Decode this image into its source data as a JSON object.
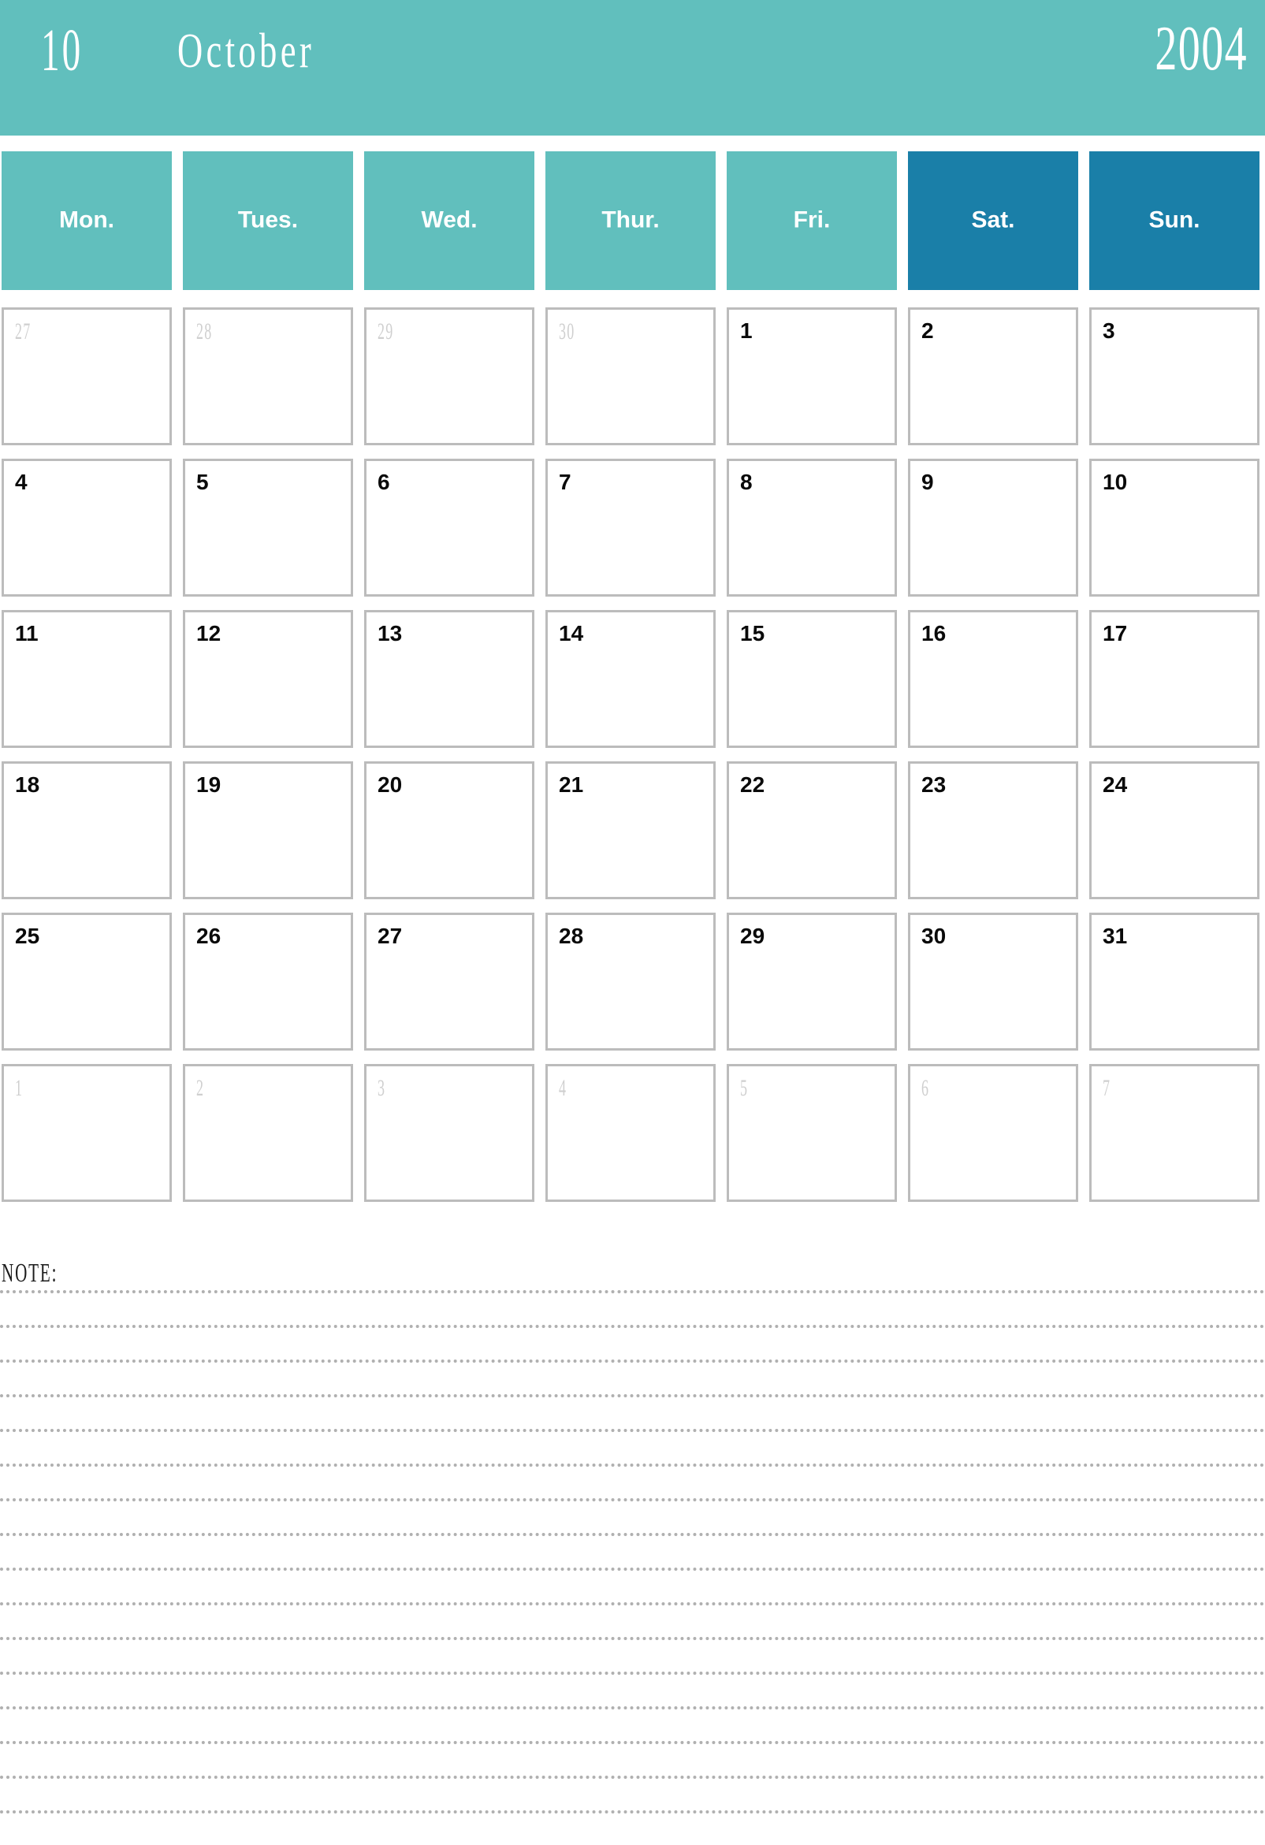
{
  "theme": {
    "primary_teal": "#61bfbd",
    "weekend_blue": "#1a7fa8",
    "cell_border": "#bcbcbc",
    "muted_text": "#cfcfcf",
    "text": "#0a0a0a",
    "note_line": "#b0b0b0"
  },
  "header": {
    "month_number": "10",
    "month_name": "October",
    "year": "2004"
  },
  "weekdays": [
    {
      "label": "Mon.",
      "type": "weekday"
    },
    {
      "label": "Tues.",
      "type": "weekday"
    },
    {
      "label": "Wed.",
      "type": "weekday"
    },
    {
      "label": "Thur.",
      "type": "weekday"
    },
    {
      "label": "Fri.",
      "type": "weekday"
    },
    {
      "label": "Sat.",
      "type": "weekend"
    },
    {
      "label": "Sun.",
      "type": "weekend"
    }
  ],
  "grid": {
    "rows": [
      [
        {
          "day": "27",
          "muted": true
        },
        {
          "day": "28",
          "muted": true
        },
        {
          "day": "29",
          "muted": true
        },
        {
          "day": "30",
          "muted": true
        },
        {
          "day": "1",
          "muted": false
        },
        {
          "day": "2",
          "muted": false
        },
        {
          "day": "3",
          "muted": false
        }
      ],
      [
        {
          "day": "4",
          "muted": false
        },
        {
          "day": "5",
          "muted": false
        },
        {
          "day": "6",
          "muted": false
        },
        {
          "day": "7",
          "muted": false
        },
        {
          "day": "8",
          "muted": false
        },
        {
          "day": "9",
          "muted": false
        },
        {
          "day": "10",
          "muted": false
        }
      ],
      [
        {
          "day": "11",
          "muted": false
        },
        {
          "day": "12",
          "muted": false
        },
        {
          "day": "13",
          "muted": false
        },
        {
          "day": "14",
          "muted": false
        },
        {
          "day": "15",
          "muted": false
        },
        {
          "day": "16",
          "muted": false
        },
        {
          "day": "17",
          "muted": false
        }
      ],
      [
        {
          "day": "18",
          "muted": false
        },
        {
          "day": "19",
          "muted": false
        },
        {
          "day": "20",
          "muted": false
        },
        {
          "day": "21",
          "muted": false
        },
        {
          "day": "22",
          "muted": false
        },
        {
          "day": "23",
          "muted": false
        },
        {
          "day": "24",
          "muted": false
        }
      ],
      [
        {
          "day": "25",
          "muted": false
        },
        {
          "day": "26",
          "muted": false
        },
        {
          "day": "27",
          "muted": false
        },
        {
          "day": "28",
          "muted": false
        },
        {
          "day": "29",
          "muted": false
        },
        {
          "day": "30",
          "muted": false
        },
        {
          "day": "31",
          "muted": false
        }
      ],
      [
        {
          "day": "1",
          "muted": true
        },
        {
          "day": "2",
          "muted": true
        },
        {
          "day": "3",
          "muted": true
        },
        {
          "day": "4",
          "muted": true
        },
        {
          "day": "5",
          "muted": true
        },
        {
          "day": "6",
          "muted": true
        },
        {
          "day": "7",
          "muted": true
        }
      ]
    ]
  },
  "note": {
    "label": "NOTE:",
    "line_count": 16
  }
}
